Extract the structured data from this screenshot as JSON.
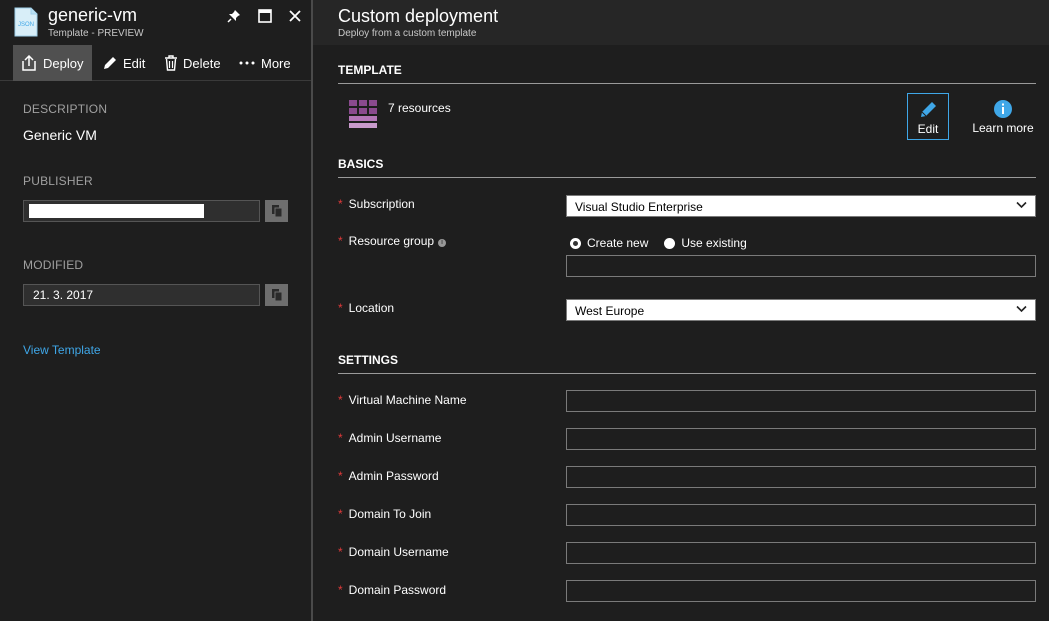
{
  "left_blade": {
    "title": "generic-vm",
    "subtitle": "Template - PREVIEW",
    "icon_label": "JSON",
    "commands": [
      {
        "label": "Deploy",
        "icon": "deploy-icon"
      },
      {
        "label": "Edit",
        "icon": "pencil-icon"
      },
      {
        "label": "Delete",
        "icon": "trash-icon"
      },
      {
        "label": "More",
        "icon": "ellipsis-icon"
      }
    ],
    "description_label": "DESCRIPTION",
    "description_value": "Generic VM",
    "publisher_label": "PUBLISHER",
    "publisher_value": "",
    "modified_label": "MODIFIED",
    "modified_value": "21. 3. 2017",
    "view_template_link": "View Template"
  },
  "right_blade": {
    "title": "Custom deployment",
    "subtitle": "Deploy from a custom template",
    "template_section": "TEMPLATE",
    "resources_text": "7 resources",
    "edit_tile_label": "Edit",
    "learn_more_label": "Learn more",
    "basics_section": "BASICS",
    "subscription_label": "Subscription",
    "subscription_value": "Visual Studio Enterprise",
    "resource_group_label": "Resource group",
    "resource_group_options": [
      "Create new",
      "Use existing"
    ],
    "resource_group_selected": "Create new",
    "resource_group_value": "",
    "location_label": "Location",
    "location_value": "West Europe",
    "settings_section": "SETTINGS",
    "settings_fields": [
      {
        "label": "Virtual Machine Name",
        "value": ""
      },
      {
        "label": "Admin Username",
        "value": ""
      },
      {
        "label": "Admin Password",
        "value": ""
      },
      {
        "label": "Domain To Join",
        "value": ""
      },
      {
        "label": "Domain Username",
        "value": ""
      },
      {
        "label": "Domain Password",
        "value": ""
      }
    ],
    "required_marker": "*",
    "info_marker": "i"
  },
  "colors": {
    "background": "#1e1e1e",
    "accent_blue": "#3fa7e8",
    "required_red": "#e03a3a",
    "resource_purple": "#8a4a8e"
  }
}
